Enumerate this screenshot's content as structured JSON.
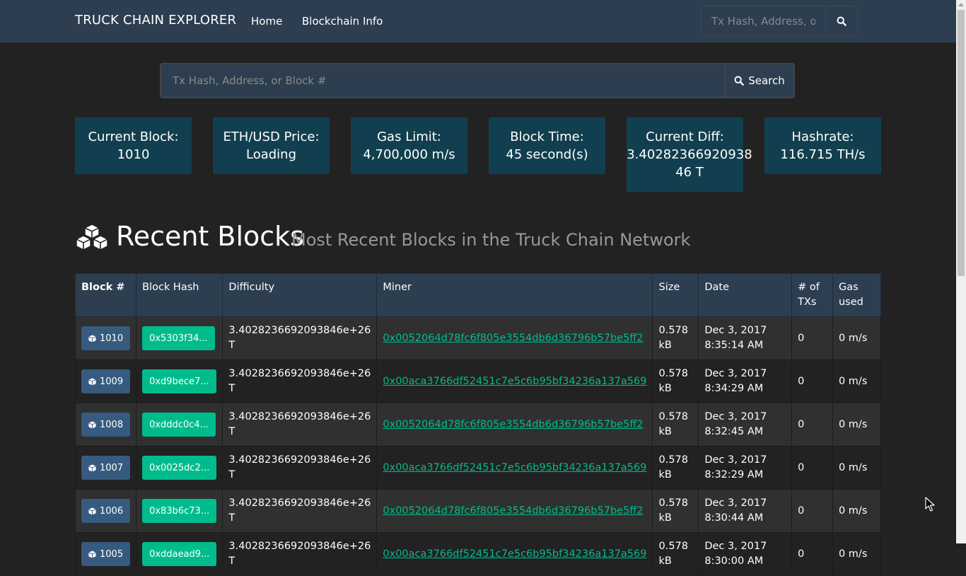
{
  "nav": {
    "brand": "TRUCK CHAIN EXPLORER",
    "home": "Home",
    "info": "Blockchain Info",
    "search_placeholder": "Tx Hash, Address, or Block #"
  },
  "search": {
    "placeholder": "Tx Hash, Address, or Block #",
    "button": "Search"
  },
  "stats": {
    "current_block_label": "Current Block:",
    "current_block_value": "1010",
    "price_label": "ETH/USD Price:",
    "price_value": "Loading",
    "gas_limit_label": "Gas Limit:",
    "gas_limit_value": "4,700,000 m/s",
    "block_time_label": "Block Time:",
    "block_time_value": "45 second(s)",
    "diff_label": "Current Diff:",
    "diff_value": "3.4028236692093846 T",
    "hashrate_label": "Hashrate:",
    "hashrate_value": "116.715 TH/s"
  },
  "heading": {
    "title": "Recent Blocks",
    "subtitle": "Most Recent Blocks in the Truck Chain Network"
  },
  "table": {
    "headers": [
      "Block #",
      "Block Hash",
      "Difficulty",
      "Miner",
      "Size",
      "Date",
      "# of TXs",
      "Gas used"
    ],
    "rows": [
      {
        "block": "1010",
        "hash": "0x5303f34...",
        "difficulty": "3.4028236692093846e+26 T",
        "miner": "0x0052064d78fc6f805e3554db6d36796b57be5ff2",
        "size": "0.578 kB",
        "date": "Dec 3, 2017 8:35:14 AM",
        "txs": "0",
        "gas": "0 m/s"
      },
      {
        "block": "1009",
        "hash": "0xd9bece7...",
        "difficulty": "3.4028236692093846e+26 T",
        "miner": "0x00aca3766df52451c7e5c6b95bf34236a137a569",
        "size": "0.578 kB",
        "date": "Dec 3, 2017 8:34:29 AM",
        "txs": "0",
        "gas": "0 m/s"
      },
      {
        "block": "1008",
        "hash": "0xdddc0c4...",
        "difficulty": "3.4028236692093846e+26 T",
        "miner": "0x0052064d78fc6f805e3554db6d36796b57be5ff2",
        "size": "0.578 kB",
        "date": "Dec 3, 2017 8:32:45 AM",
        "txs": "0",
        "gas": "0 m/s"
      },
      {
        "block": "1007",
        "hash": "0x0025dc2...",
        "difficulty": "3.4028236692093846e+26 T",
        "miner": "0x00aca3766df52451c7e5c6b95bf34236a137a569",
        "size": "0.578 kB",
        "date": "Dec 3, 2017 8:32:29 AM",
        "txs": "0",
        "gas": "0 m/s"
      },
      {
        "block": "1006",
        "hash": "0x83b6c73...",
        "difficulty": "3.4028236692093846e+26 T",
        "miner": "0x0052064d78fc6f805e3554db6d36796b57be5ff2",
        "size": "0.578 kB",
        "date": "Dec 3, 2017 8:30:44 AM",
        "txs": "0",
        "gas": "0 m/s"
      },
      {
        "block": "1005",
        "hash": "0xddaead9...",
        "difficulty": "3.4028236692093846e+26 T",
        "miner": "0x00aca3766df52451c7e5c6b95bf34236a137a569",
        "size": "0.578 kB",
        "date": "Dec 3, 2017 8:30:00 AM",
        "txs": "0",
        "gas": "0 m/s"
      }
    ]
  },
  "colors": {
    "navbar": "#2c3e50",
    "stat_card": "#123f4f",
    "primary_button": "#375a7f",
    "success_button": "#00bc8c",
    "background": "#222222"
  },
  "icons": {
    "search": "search-icon",
    "cube": "cube-icon",
    "cubes": "cubes-icon"
  }
}
